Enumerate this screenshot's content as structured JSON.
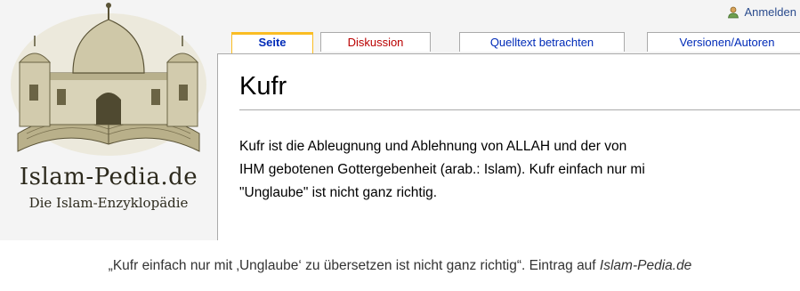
{
  "logo": {
    "title": "Islam-Pedia.de",
    "subtitle": "Die Islam-Enzyklopädie"
  },
  "personal_tools": {
    "login_label": "Anmelden"
  },
  "tabs": [
    {
      "label": "Seite",
      "state": "selected"
    },
    {
      "label": "Diskussion",
      "state": "new"
    },
    {
      "label": "Quelltext betrachten",
      "state": "normal"
    },
    {
      "label": "Versionen/Autoren",
      "state": "normal"
    }
  ],
  "article": {
    "title": "Kufr",
    "lines": [
      "Kufr ist die Ableugnung und Ablehnung von ALLAH und der von",
      "IHM gebotenen Gottergebenheit (arab.: Islam). Kufr einfach nur mi",
      "\"Unglaube\" ist nicht ganz richtig."
    ]
  },
  "caption": {
    "text": "„Kufr einfach nur mit ‚Unglaube‘ zu übersetzen ist nicht ganz richtig“. Eintrag auf ",
    "source": "Islam-Pedia.de"
  },
  "colors": {
    "tab_selected_border": "#fabd23",
    "link": "#002bb8",
    "new_link": "#ba0000",
    "background": "#f4f4f4"
  }
}
